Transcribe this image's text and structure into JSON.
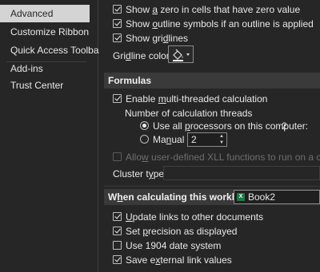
{
  "sidebar": {
    "items": [
      {
        "label": "Advanced",
        "selected": true
      },
      {
        "label": "Customize Ribbon",
        "selected": false
      },
      {
        "label": "Quick Access Toolbar",
        "selected": false
      },
      {
        "label": "Add-ins",
        "selected": false
      },
      {
        "label": "Trust Center",
        "selected": false
      }
    ]
  },
  "display_options": {
    "show_zero": {
      "label_pre": "Show ",
      "label_ul": "a",
      "label_post": " zero in cells that have zero value",
      "checked": true
    },
    "show_outline": {
      "label_pre": "Show ",
      "label_ul": "o",
      "label_post": "utline symbols if an outline is applied",
      "checked": true
    },
    "show_gridlines": {
      "label_pre": "Show gri",
      "label_ul": "d",
      "label_post": "lines",
      "checked": true
    },
    "gridline_color_label_pre": "Gri",
    "gridline_color_label_ul": "d",
    "gridline_color_label_post": "line color"
  },
  "formulas": {
    "header": "Formulas",
    "multithreaded": {
      "label_pre": "Enable ",
      "label_ul": "m",
      "label_post": "ulti-threaded calculation",
      "checked": true
    },
    "threads_label": "Number of calculation threads",
    "use_all": {
      "label_pre": "Use all ",
      "label_ul": "p",
      "label_post": "rocessors on this computer:",
      "value": "2",
      "selected": true
    },
    "manual": {
      "label_pre": "Ma",
      "label_ul": "n",
      "label_post": "ual",
      "value": "2",
      "selected": false
    },
    "allow_xll": {
      "label_pre": "Allo",
      "label_ul": "w",
      "label_post": " user-defined XLL functions to run on a compute clu",
      "checked": false,
      "disabled": true
    },
    "cluster_type_label_pre": "Cluster t",
    "cluster_type_label_ul": "y",
    "cluster_type_label_post": "pe:"
  },
  "calculating": {
    "header_pre": "W",
    "header_ul": "h",
    "header_post": "en calculating this workbook:",
    "workbook": "Book2",
    "workbook_icon": "excel-icon",
    "update_links": {
      "label_pre": "",
      "label_ul": "U",
      "label_post": "pdate links to other documents",
      "checked": true
    },
    "set_precision": {
      "label_pre": "Set ",
      "label_ul": "p",
      "label_post": "recision as displayed",
      "checked": true
    },
    "use_1904": {
      "label_pre": "Use 1904 ",
      "label_ul": "",
      "label_post": "date system",
      "checked": false
    },
    "save_external": {
      "label_pre": "Save e",
      "label_ul": "x",
      "label_post": "ternal link values",
      "checked": true
    }
  },
  "colors": {
    "background": "#262626",
    "selected_sidebar": "#d4d4d4",
    "section_header": "#3a3a3a",
    "excel_green": "#1f7a45"
  }
}
